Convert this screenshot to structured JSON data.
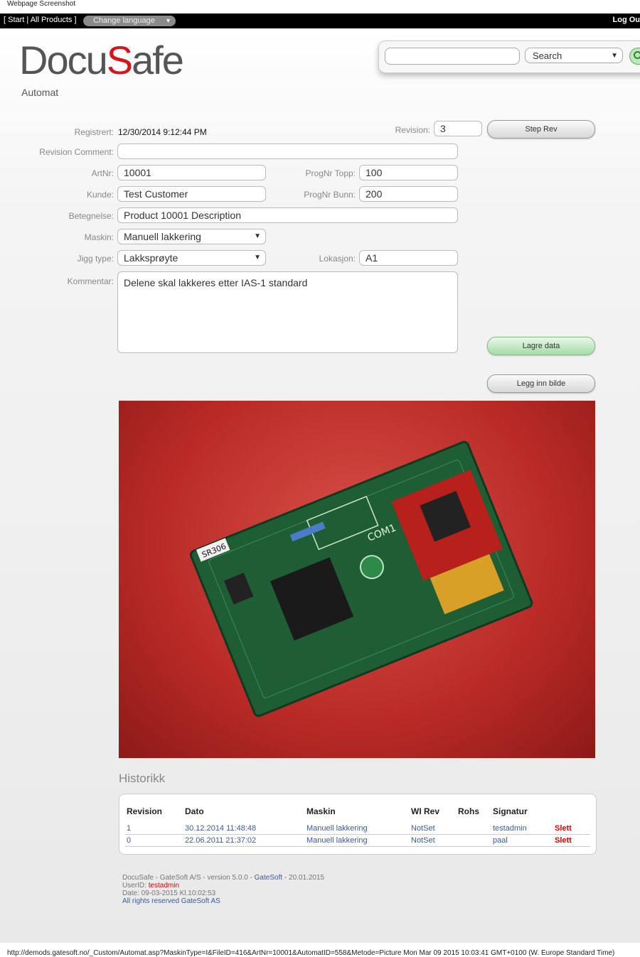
{
  "caption": "Webpage Screenshot",
  "topbar": {
    "nav": "[ Start | All Products ]",
    "language_label": "Change language",
    "logout": "Log Ou"
  },
  "logo": {
    "part1": "Docu",
    "part2": "S",
    "part3": "afe"
  },
  "subtitle": "Automat",
  "search": {
    "value": "",
    "scope": "Search"
  },
  "form": {
    "registrert_label": "Registrert:",
    "registrert_value": "12/30/2014 9:12:44 PM",
    "revision_label": "Revision:",
    "revision_value": "3",
    "step_rev_button": "Step Rev",
    "revision_comment_label": "Revision Comment:",
    "revision_comment_value": "",
    "artnr_label": "ArtNr:",
    "artnr_value": "10001",
    "prognr_topp_label": "ProgNr Topp:",
    "prognr_topp_value": "100",
    "kunde_label": "Kunde:",
    "kunde_value": "Test Customer",
    "prognr_bunn_label": "ProgNr Bunn:",
    "prognr_bunn_value": "200",
    "betegnelse_label": "Betegnelse:",
    "betegnelse_value": "Product 10001 Description",
    "maskin_label": "Maskin:",
    "maskin_value": "Manuell lakkering",
    "jigg_label": "Jigg type:",
    "jigg_value": "Lakksprøyte",
    "lokasjon_label": "Lokasjon:",
    "lokasjon_value": "A1",
    "kommentar_label": "Kommentar:",
    "kommentar_value": "Delene skal lakkeres etter IAS-1 standard",
    "save_button": "Lagre data",
    "add_image_button": "Legg inn bilde"
  },
  "history": {
    "title": "Historikk",
    "columns": [
      "Revision",
      "Dato",
      "Maskin",
      "WI Rev",
      "Rohs",
      "Signatur"
    ],
    "rows": [
      {
        "revision": "1",
        "dato": "30.12.2014 11:48:48",
        "maskin": "Manuell lakkering",
        "wirev": "NotSet",
        "rohs": "",
        "signatur": "testadmin",
        "action": "Slett"
      },
      {
        "revision": "0",
        "dato": "22.06.2011 21:37:02",
        "maskin": "Manuell lakkering",
        "wirev": "NotSet",
        "rohs": "",
        "signatur": "paal",
        "action": "Slett"
      }
    ]
  },
  "footer": {
    "line1_a": "DocuSafe - GateSoft A/S - version 5.0.0 -",
    "line1_link": "GateSoft",
    "line1_b": "- 20.01.2015",
    "userid_label": "UserID:",
    "userid_value": "testadmin",
    "date_line": "Date: 09-03-2015  Kl.10:02:53",
    "rights": "All rights reserved GateSoft AS"
  },
  "statusbar": "http://demods.gatesoft.no/_Custom/Automat.asp?MaskinType=I&FileID=416&ArtNr=10001&AutomatID=558&Metode=Picture Mon Mar 09 2015 10:03:41 GMT+0100 (W. Europe Standard Time)",
  "photo_labels": {
    "chip_tag": "SR306",
    "board_text": "COM1"
  },
  "colors": {
    "brand_red": "#d8141b",
    "link_blue": "#3b5a9a",
    "pcb_green": "#1f5e34",
    "photo_red": "#c0332e"
  }
}
